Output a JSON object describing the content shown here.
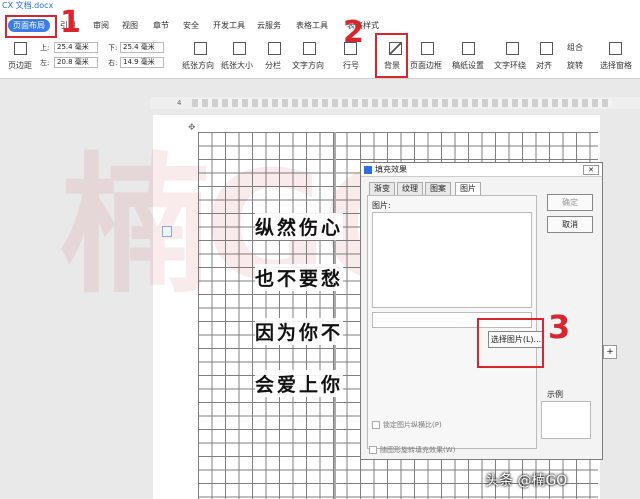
{
  "window": {
    "title": "CX 文档.docx"
  },
  "tabs": [
    "页面布局",
    "引用",
    "审阅",
    "视图",
    "章节",
    "安全",
    "开发工具",
    "云服务",
    "表格工具",
    "表格样式"
  ],
  "ribbon": {
    "margins_label": "页边距",
    "top_label": "上:",
    "top_value": "25.4 毫米",
    "bottom_label": "下:",
    "bottom_value": "25.4 毫米",
    "left_label": "左:",
    "left_value": "20.8 毫米",
    "right_label": "右:",
    "right_value": "14.9 毫米",
    "orientation": "纸张方向",
    "size": "纸张大小",
    "columns": "分栏",
    "text_direction": "文字方向",
    "line_numbers": "行号",
    "background": "背景",
    "page_border": "页面边框",
    "draft_settings": "稿纸设置",
    "text_wrap": "文字环绕",
    "align": "对齐",
    "group": "组合",
    "rotate": "旋转",
    "selection_pane": "选择窗格"
  },
  "ruler_ticks": [
    "4",
    "2"
  ],
  "steps": [
    "1",
    "2",
    "3"
  ],
  "watermark": "楠GO",
  "verses": [
    "纵然伤心",
    "也不要愁",
    "因为你不",
    "会爱上你"
  ],
  "dialog": {
    "title": "填充效果",
    "close": "✕",
    "tabs": [
      "渐变",
      "纹理",
      "图案",
      "图片"
    ],
    "picture_label": "图片:",
    "ok": "确定",
    "cancel": "取消",
    "select_picture": "选择图片(L)...",
    "sample_label": "示例",
    "lock_ratio": "锁定图片纵横比(P)",
    "rotate_with_shape": "随图形旋转填充效果(W)"
  },
  "credit": "头条 @楠GO",
  "accent": "#3a7ee6",
  "highlight_color": "#d9262e"
}
